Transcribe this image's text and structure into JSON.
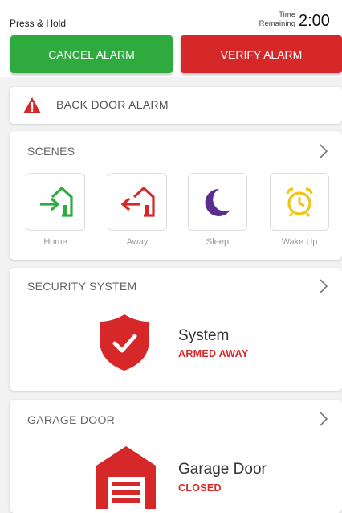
{
  "header": {
    "press_hold": "Press & Hold",
    "time_label_1": "Time",
    "time_label_2": "Remaining",
    "time_value": "2:00"
  },
  "actions": {
    "cancel_label": "CANCEL ALARM",
    "verify_label": "VERIFY ALARM",
    "cancel_color": "#2eaa3f",
    "verify_color": "#d62828"
  },
  "alarm": {
    "icon": "warning-triangle-icon",
    "text": "BACK DOOR ALARM"
  },
  "scenes": {
    "title": "SCENES",
    "items": [
      {
        "label": "Home",
        "icon": "home-arrive-icon",
        "color": "#2eaa3f"
      },
      {
        "label": "Away",
        "icon": "home-leave-icon",
        "color": "#d62828"
      },
      {
        "label": "Sleep",
        "icon": "moon-icon",
        "color": "#5b2d8e"
      },
      {
        "label": "Wake Up",
        "icon": "alarm-clock-icon",
        "color": "#f0c419"
      }
    ]
  },
  "security": {
    "title": "SECURITY SYSTEM",
    "icon": "shield-check-icon",
    "name": "System",
    "status": "ARMED AWAY",
    "status_color": "#d62828"
  },
  "garage": {
    "title": "GARAGE DOOR",
    "icon": "garage-icon",
    "name": "Garage Door",
    "status": "CLOSED",
    "status_color": "#d62828"
  }
}
